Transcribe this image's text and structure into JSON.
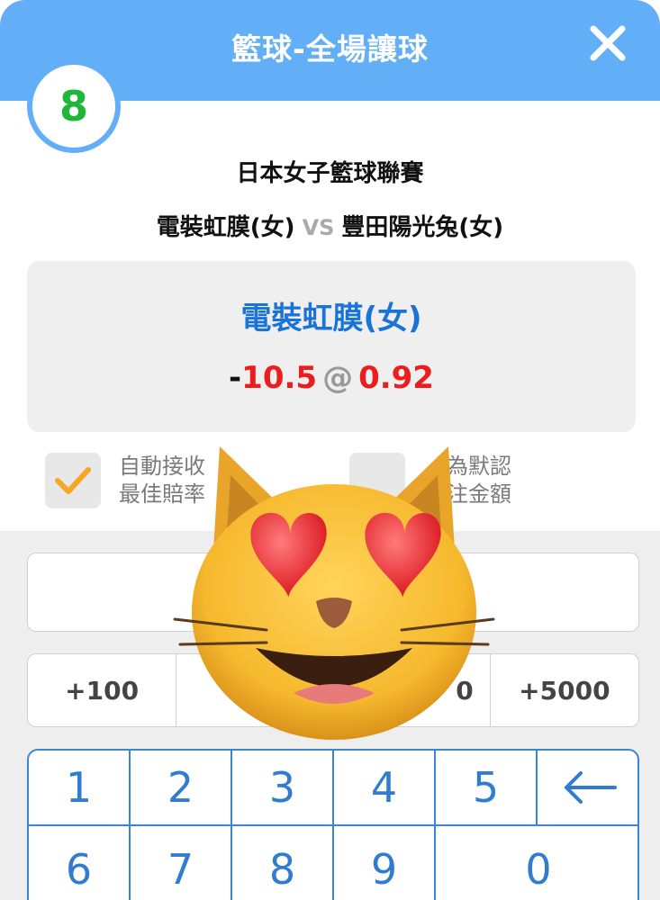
{
  "header": {
    "title": "籃球-全場讓球",
    "close_icon": "close-icon"
  },
  "badge": {
    "number": "8"
  },
  "match": {
    "league": "日本女子籃球聯賽",
    "home": "電裝虹膜(女)",
    "vs": "VS",
    "away": "豐田陽光兔(女)"
  },
  "selection": {
    "team": "電裝虹膜(女)",
    "handicap_sign": "-",
    "handicap": "10.5",
    "at": "@",
    "odds": "0.92"
  },
  "options": {
    "auto_accept": {
      "line1": "自動接收",
      "line2": "最佳賠率",
      "checked": true
    },
    "default_stake": {
      "line1": "為默認",
      "line2": "注金額",
      "checked": false
    }
  },
  "stake_input": {
    "value": ""
  },
  "quick_amounts": [
    "+100",
    "",
    "0",
    "+5000"
  ],
  "keypad": {
    "row1": [
      "1",
      "2",
      "3",
      "4",
      "5"
    ],
    "backspace_icon": "arrow-left-icon",
    "row2": [
      "6",
      "7",
      "8",
      "9"
    ],
    "zero": "0"
  },
  "overlay_emoji": "smiling-cat-heart-eyes-emoji",
  "colors": {
    "header": "#62aff7",
    "badge_number": "#1fb73a",
    "team": "#1a73d9",
    "odds": "#ec1d1d",
    "keypad": "#3a86d6"
  }
}
